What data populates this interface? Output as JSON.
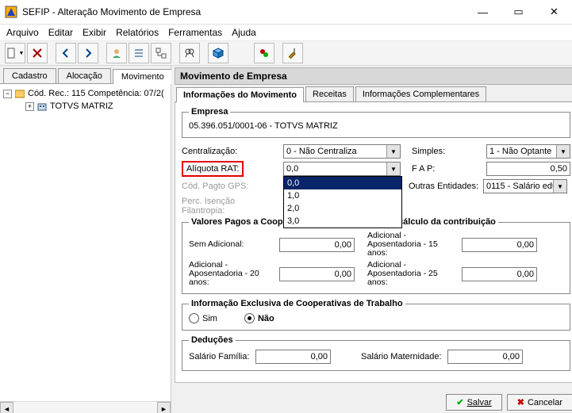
{
  "window": {
    "title": "SEFIP - Alteração Movimento de Empresa"
  },
  "menu": {
    "arquivo": "Arquivo",
    "editar": "Editar",
    "exibir": "Exibir",
    "relatorios": "Relatórios",
    "ferramentas": "Ferramentas",
    "ajuda": "Ajuda"
  },
  "tabs": {
    "cadastro": "Cadastro",
    "alocacao": "Alocação",
    "movimento": "Movimento"
  },
  "tree": {
    "root": "Cód. Rec.: 115 Competência: 07/2(",
    "child1": "TOTVS MATRIZ"
  },
  "section": {
    "title": "Movimento de Empresa"
  },
  "itabs": {
    "info": "Informações do Movimento",
    "receitas": "Receitas",
    "compl": "Informações Complementares"
  },
  "empresa": {
    "legend": "Empresa",
    "value": "05.396.051/0001-06 -  TOTVS MATRIZ"
  },
  "form": {
    "centralizacao_lbl": "Centralização:",
    "centralizacao_val": "0 - Não Centraliza",
    "simples_lbl": "Simples:",
    "simples_val": "1 - Não Optante",
    "aliquota_lbl": "Alíquota RAT:",
    "aliquota_val": "0,0",
    "fap_lbl": "F A P:",
    "fap_val": "0,50",
    "codpagto_lbl": "Cód. Pagto GPS:",
    "outras_lbl": "Outras Entidades:",
    "outras_val": "0115 - Salário educ",
    "perciso_lbl": "Perc. Isenção Filantropia:"
  },
  "dropdown": {
    "o0": "0,0",
    "o1": "1,0",
    "o2": "2,0",
    "o3": "3,0"
  },
  "coop": {
    "legend": "Valores Pagos a Cooperativas de Trabalho - Base cálculo da contribuição",
    "sem_lbl": "Sem Adicional:",
    "sem_val": "0,00",
    "ad15_lbl": "Adicional - Aposentadoria - 15 anos:",
    "ad15_val": "0,00",
    "ad20_lbl": "Adicional - Aposentadoria - 20 anos:",
    "ad20_val": "0,00",
    "ad25_lbl": "Adicional - Aposentadoria - 25 anos:",
    "ad25_val": "0,00"
  },
  "infoexcl": {
    "legend": "Informação Exclusiva de Cooperativas de Trabalho",
    "sim": "Sim",
    "nao": "Não"
  },
  "ded": {
    "legend": "Deduções",
    "sal_familia_lbl": "Salário Família:",
    "sal_familia_val": "0,00",
    "sal_mat_lbl": "Salário Maternidade:",
    "sal_mat_val": "0,00"
  },
  "buttons": {
    "salvar": "Salvar",
    "cancelar": "Cancelar"
  }
}
